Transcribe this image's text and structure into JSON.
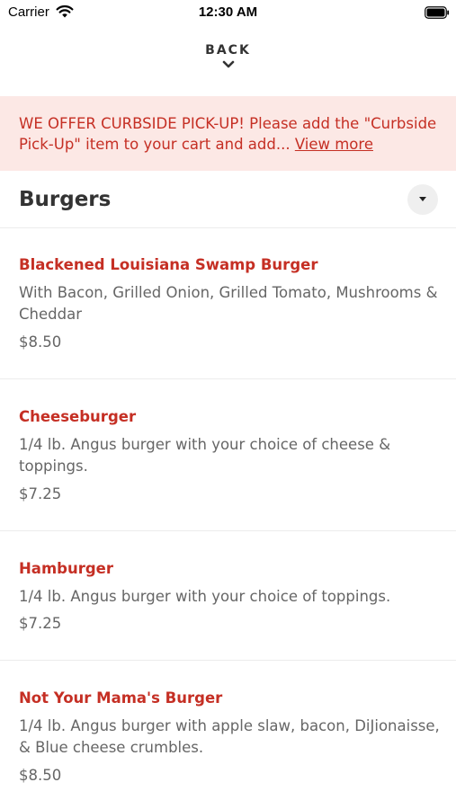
{
  "status_bar": {
    "carrier": "Carrier",
    "time": "12:30 AM"
  },
  "nav": {
    "back_label": "BACK"
  },
  "banner": {
    "text": "WE OFFER CURBSIDE PICK-UP! Please add the \"Curbside Pick-Up\" item to your cart and add...",
    "link": "View more",
    "bg_color": "#fce8e5",
    "text_color": "#c52f24"
  },
  "category": {
    "title": "Burgers"
  },
  "items": [
    {
      "name": "Blackened Louisiana Swamp Burger",
      "description": "With Bacon, Grilled Onion, Grilled Tomato, Mushrooms & Cheddar",
      "price": "$8.50"
    },
    {
      "name": "Cheeseburger",
      "description": "1/4 lb. Angus burger with your choice of cheese & toppings.",
      "price": "$7.25"
    },
    {
      "name": "Hamburger",
      "description": "1/4 lb. Angus burger with your choice of toppings.",
      "price": "$7.25"
    },
    {
      "name": "Not Your Mama's Burger",
      "description": "1/4 lb. Angus burger with apple slaw, bacon, DiJionaisse, & Blue cheese crumbles.",
      "price": "$8.50"
    }
  ],
  "accent_color": "#c52f24"
}
